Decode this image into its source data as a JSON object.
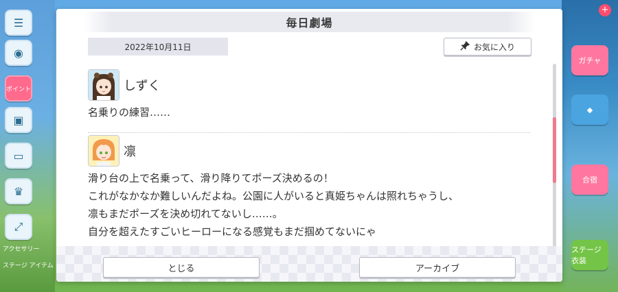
{
  "dialog": {
    "title": "毎日劇場",
    "date": "2022年10月11日",
    "favorite_label": "お気に入り",
    "entries": [
      {
        "speaker": "しずく",
        "lines": [
          "名乗りの練習……"
        ]
      },
      {
        "speaker": "凛",
        "lines": [
          "滑り台の上で名乗って、滑り降りてポーズ決めるの！",
          "これがなかなか難しいんだよね。公園に人がいると真姫ちゃんは照れちゃうし、",
          "凛もまだポーズを決め切れてないし……。",
          "自分を超えたすごいヒーローになる感覚もまだ掴めてないにゃ"
        ]
      }
    ],
    "close_label": "とじる",
    "archive_label": "アーカイブ"
  },
  "background": {
    "left_badge": "ポイント",
    "left_labels": [
      "アクセサリー",
      "ステージ アイテム"
    ],
    "right_labels": [
      "ガチャ",
      "合宿",
      "ステージ 衣装"
    ]
  },
  "colors": {
    "accent_pink": "#f07a8c",
    "title_bg": "#e9eaf0",
    "date_bg": "#e3e4ec"
  },
  "icons": {
    "favorite": "pin-icon",
    "scroll": "scrollbar"
  }
}
